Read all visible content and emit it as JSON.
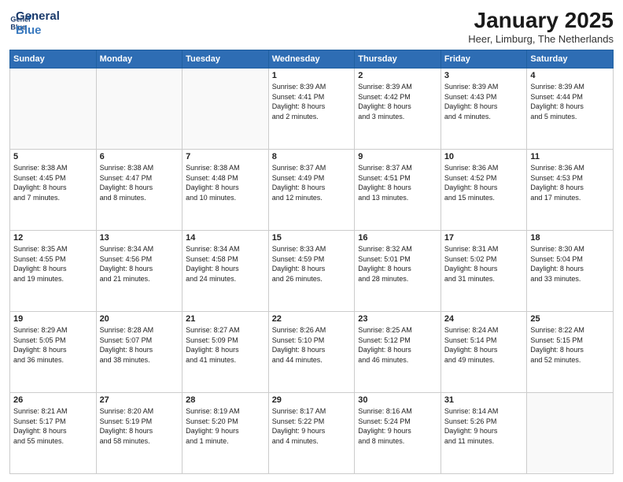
{
  "logo": {
    "line1": "General",
    "line2": "Blue"
  },
  "title": "January 2025",
  "subtitle": "Heer, Limburg, The Netherlands",
  "weekdays": [
    "Sunday",
    "Monday",
    "Tuesday",
    "Wednesday",
    "Thursday",
    "Friday",
    "Saturday"
  ],
  "weeks": [
    [
      {
        "day": "",
        "info": ""
      },
      {
        "day": "",
        "info": ""
      },
      {
        "day": "",
        "info": ""
      },
      {
        "day": "1",
        "info": "Sunrise: 8:39 AM\nSunset: 4:41 PM\nDaylight: 8 hours\nand 2 minutes."
      },
      {
        "day": "2",
        "info": "Sunrise: 8:39 AM\nSunset: 4:42 PM\nDaylight: 8 hours\nand 3 minutes."
      },
      {
        "day": "3",
        "info": "Sunrise: 8:39 AM\nSunset: 4:43 PM\nDaylight: 8 hours\nand 4 minutes."
      },
      {
        "day": "4",
        "info": "Sunrise: 8:39 AM\nSunset: 4:44 PM\nDaylight: 8 hours\nand 5 minutes."
      }
    ],
    [
      {
        "day": "5",
        "info": "Sunrise: 8:38 AM\nSunset: 4:45 PM\nDaylight: 8 hours\nand 7 minutes."
      },
      {
        "day": "6",
        "info": "Sunrise: 8:38 AM\nSunset: 4:47 PM\nDaylight: 8 hours\nand 8 minutes."
      },
      {
        "day": "7",
        "info": "Sunrise: 8:38 AM\nSunset: 4:48 PM\nDaylight: 8 hours\nand 10 minutes."
      },
      {
        "day": "8",
        "info": "Sunrise: 8:37 AM\nSunset: 4:49 PM\nDaylight: 8 hours\nand 12 minutes."
      },
      {
        "day": "9",
        "info": "Sunrise: 8:37 AM\nSunset: 4:51 PM\nDaylight: 8 hours\nand 13 minutes."
      },
      {
        "day": "10",
        "info": "Sunrise: 8:36 AM\nSunset: 4:52 PM\nDaylight: 8 hours\nand 15 minutes."
      },
      {
        "day": "11",
        "info": "Sunrise: 8:36 AM\nSunset: 4:53 PM\nDaylight: 8 hours\nand 17 minutes."
      }
    ],
    [
      {
        "day": "12",
        "info": "Sunrise: 8:35 AM\nSunset: 4:55 PM\nDaylight: 8 hours\nand 19 minutes."
      },
      {
        "day": "13",
        "info": "Sunrise: 8:34 AM\nSunset: 4:56 PM\nDaylight: 8 hours\nand 21 minutes."
      },
      {
        "day": "14",
        "info": "Sunrise: 8:34 AM\nSunset: 4:58 PM\nDaylight: 8 hours\nand 24 minutes."
      },
      {
        "day": "15",
        "info": "Sunrise: 8:33 AM\nSunset: 4:59 PM\nDaylight: 8 hours\nand 26 minutes."
      },
      {
        "day": "16",
        "info": "Sunrise: 8:32 AM\nSunset: 5:01 PM\nDaylight: 8 hours\nand 28 minutes."
      },
      {
        "day": "17",
        "info": "Sunrise: 8:31 AM\nSunset: 5:02 PM\nDaylight: 8 hours\nand 31 minutes."
      },
      {
        "day": "18",
        "info": "Sunrise: 8:30 AM\nSunset: 5:04 PM\nDaylight: 8 hours\nand 33 minutes."
      }
    ],
    [
      {
        "day": "19",
        "info": "Sunrise: 8:29 AM\nSunset: 5:05 PM\nDaylight: 8 hours\nand 36 minutes."
      },
      {
        "day": "20",
        "info": "Sunrise: 8:28 AM\nSunset: 5:07 PM\nDaylight: 8 hours\nand 38 minutes."
      },
      {
        "day": "21",
        "info": "Sunrise: 8:27 AM\nSunset: 5:09 PM\nDaylight: 8 hours\nand 41 minutes."
      },
      {
        "day": "22",
        "info": "Sunrise: 8:26 AM\nSunset: 5:10 PM\nDaylight: 8 hours\nand 44 minutes."
      },
      {
        "day": "23",
        "info": "Sunrise: 8:25 AM\nSunset: 5:12 PM\nDaylight: 8 hours\nand 46 minutes."
      },
      {
        "day": "24",
        "info": "Sunrise: 8:24 AM\nSunset: 5:14 PM\nDaylight: 8 hours\nand 49 minutes."
      },
      {
        "day": "25",
        "info": "Sunrise: 8:22 AM\nSunset: 5:15 PM\nDaylight: 8 hours\nand 52 minutes."
      }
    ],
    [
      {
        "day": "26",
        "info": "Sunrise: 8:21 AM\nSunset: 5:17 PM\nDaylight: 8 hours\nand 55 minutes."
      },
      {
        "day": "27",
        "info": "Sunrise: 8:20 AM\nSunset: 5:19 PM\nDaylight: 8 hours\nand 58 minutes."
      },
      {
        "day": "28",
        "info": "Sunrise: 8:19 AM\nSunset: 5:20 PM\nDaylight: 9 hours\nand 1 minute."
      },
      {
        "day": "29",
        "info": "Sunrise: 8:17 AM\nSunset: 5:22 PM\nDaylight: 9 hours\nand 4 minutes."
      },
      {
        "day": "30",
        "info": "Sunrise: 8:16 AM\nSunset: 5:24 PM\nDaylight: 9 hours\nand 8 minutes."
      },
      {
        "day": "31",
        "info": "Sunrise: 8:14 AM\nSunset: 5:26 PM\nDaylight: 9 hours\nand 11 minutes."
      },
      {
        "day": "",
        "info": ""
      }
    ]
  ]
}
